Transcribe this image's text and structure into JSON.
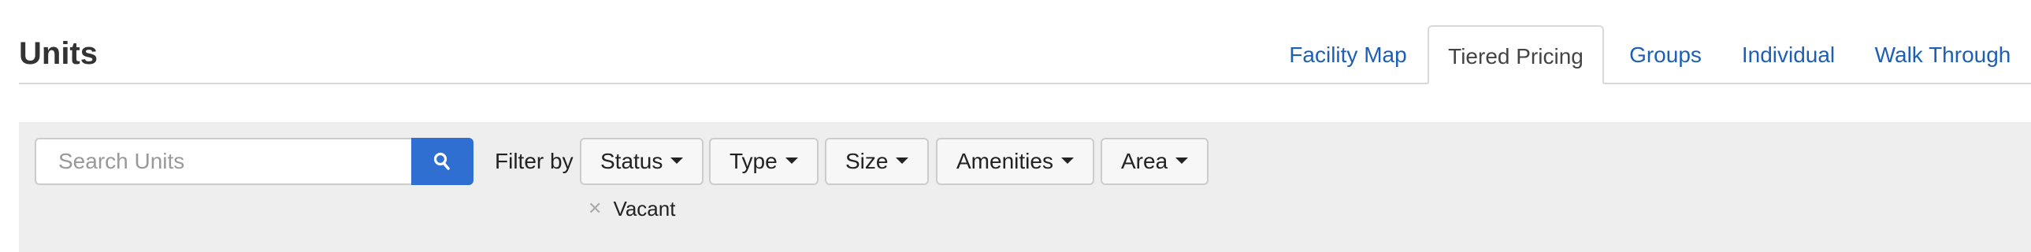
{
  "header": {
    "title": "Units"
  },
  "tabs": [
    {
      "label": "Facility Map",
      "active": false
    },
    {
      "label": "Tiered Pricing",
      "active": true
    },
    {
      "label": "Groups",
      "active": false
    },
    {
      "label": "Individual",
      "active": false
    },
    {
      "label": "Walk Through",
      "active": false
    }
  ],
  "search": {
    "placeholder": "Search Units",
    "value": "",
    "button_icon": "search-icon"
  },
  "filters": {
    "label": "Filter by",
    "dropdowns": [
      {
        "label": "Status",
        "icon": "caret-down-icon"
      },
      {
        "label": "Type",
        "icon": "caret-down-icon"
      },
      {
        "label": "Size",
        "icon": "caret-down-icon"
      },
      {
        "label": "Amenities",
        "icon": "caret-down-icon"
      },
      {
        "label": "Area",
        "icon": "caret-down-icon"
      }
    ],
    "active": [
      {
        "label": "Vacant",
        "remove_icon": "close-icon"
      }
    ]
  },
  "colors": {
    "link": "#1d5fb4",
    "search_button": "#2f6fd1",
    "panel_bg": "#eeeeee",
    "title": "#333333"
  }
}
